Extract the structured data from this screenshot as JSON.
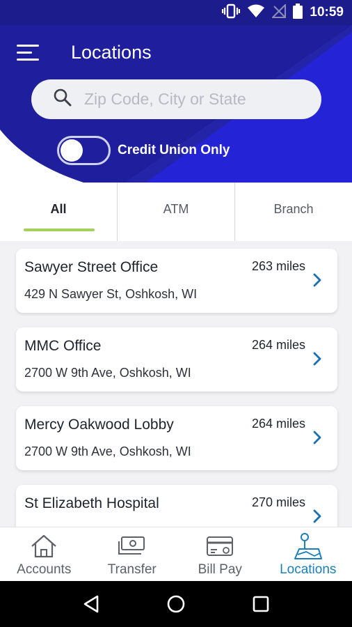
{
  "status_bar": {
    "time": "10:59"
  },
  "header": {
    "title": "Locations",
    "search_placeholder": "Zip Code, City or State",
    "toggle_label": "Credit Union Only",
    "toggle_on": false
  },
  "tabs": [
    {
      "label": "All",
      "active": true
    },
    {
      "label": "ATM",
      "active": false
    },
    {
      "label": "Branch",
      "active": false
    }
  ],
  "locations": [
    {
      "name": "Sawyer Street Office",
      "distance": "263 miles",
      "address": "429 N Sawyer St, Oshkosh, WI"
    },
    {
      "name": "MMC Office",
      "distance": "264 miles",
      "address": "2700 W 9th Ave, Oshkosh, WI"
    },
    {
      "name": "Mercy Oakwood Lobby",
      "distance": "264 miles",
      "address": "2700 W 9th Ave, Oshkosh, WI"
    },
    {
      "name": "St Elizabeth Hospital",
      "distance": "270 miles",
      "address": ""
    }
  ],
  "bottom_nav": [
    {
      "label": "Accounts",
      "icon": "home-icon",
      "active": false
    },
    {
      "label": "Transfer",
      "icon": "transfer-icon",
      "active": false
    },
    {
      "label": "Bill Pay",
      "icon": "bill-pay-icon",
      "active": false
    },
    {
      "label": "Locations",
      "icon": "map-pin-icon",
      "active": true
    }
  ],
  "colors": {
    "brand_blue": "#1f1f9e",
    "accent_green": "#a4d05b",
    "active_nav": "#1a7fb8",
    "chevron": "#1a6fb0"
  }
}
